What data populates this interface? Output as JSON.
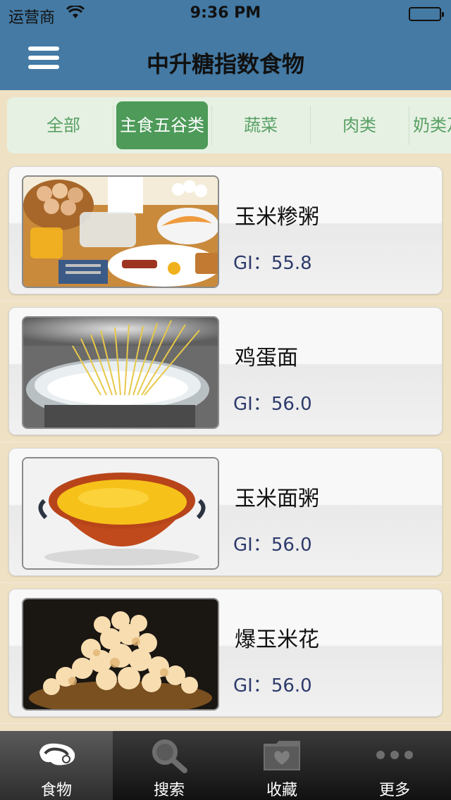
{
  "status": {
    "carrier": "运营商",
    "time": "9:36 PM"
  },
  "nav": {
    "title": "中升糖指数食物",
    "menu_icon": "hamburger-menu-icon"
  },
  "categories": [
    {
      "label": "全部",
      "selected": false
    },
    {
      "label": "主食五谷类",
      "selected": true
    },
    {
      "label": "蔬菜",
      "selected": false
    },
    {
      "label": "肉类",
      "selected": false
    },
    {
      "label": "奶类及",
      "selected": false
    }
  ],
  "foods": [
    {
      "name": "玉米糁粥",
      "gi": "GI：55.8",
      "image": "breakfast-photo"
    },
    {
      "name": "鸡蛋面",
      "gi": "GI：56.0",
      "image": "noodles-boiling-photo"
    },
    {
      "name": "玉米面粥",
      "gi": "GI：56.0",
      "image": "corn-porridge-bowl-photo"
    },
    {
      "name": "爆玉米花",
      "gi": "GI：56.0",
      "image": "popcorn-photo"
    }
  ],
  "tabbar": [
    {
      "label": "食物",
      "icon": "meat-icon",
      "active": true
    },
    {
      "label": "搜索",
      "icon": "search-icon",
      "active": false
    },
    {
      "label": "收藏",
      "icon": "heart-folder-icon",
      "active": false
    },
    {
      "label": "更多",
      "icon": "more-dots-icon",
      "active": false
    }
  ],
  "colors": {
    "navbar": "#447aa4",
    "background": "#efe1c4",
    "tab_active": "#4d9a59",
    "tab_text": "#58a064",
    "gi_text": "#2d3a6b"
  }
}
